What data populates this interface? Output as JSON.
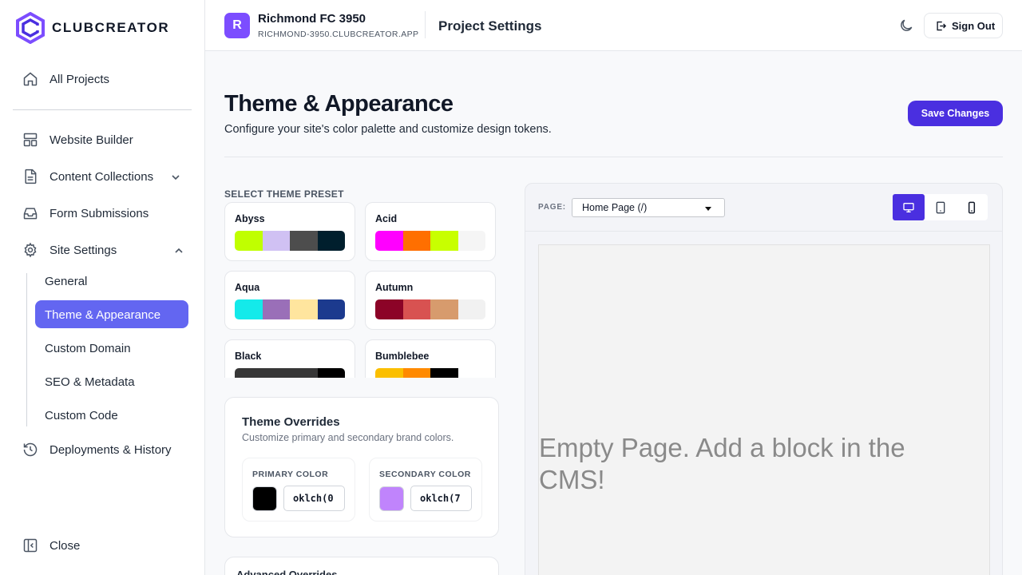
{
  "brand": {
    "name": "CLUBCREATOR"
  },
  "sidebar": {
    "all_projects": "All Projects",
    "items": [
      {
        "label": "Website Builder"
      },
      {
        "label": "Content Collections"
      },
      {
        "label": "Form Submissions"
      },
      {
        "label": "Site Settings"
      },
      {
        "label": "Deployments & History"
      }
    ],
    "sub_items": [
      "General",
      "Theme & Appearance",
      "Custom Domain",
      "SEO & Metadata",
      "Custom Code"
    ],
    "close_label": "Close"
  },
  "topbar": {
    "project_initial": "R",
    "project_name": "Richmond FC 3950",
    "project_url": "RICHMOND-3950.CLUBCREATOR.APP",
    "section_title": "Project Settings",
    "sign_out": "Sign Out"
  },
  "main": {
    "title": "Theme & Appearance",
    "subtitle": "Configure your site's color palette and customize design tokens.",
    "save_button": "Save Changes",
    "preset_label": "SELECT THEME PRESET",
    "presets": [
      {
        "name": "Abyss",
        "colors": [
          "#c0ff00",
          "#d0c1f3",
          "#4d4d4d",
          "#001f2d"
        ]
      },
      {
        "name": "Acid",
        "colors": [
          "#ff00ff",
          "#ff6f00",
          "#c8ff00",
          "#f5f5f5"
        ]
      },
      {
        "name": "Aqua",
        "colors": [
          "#14eaea",
          "#9a6fb8",
          "#ffe59e",
          "#1c3a8e"
        ]
      },
      {
        "name": "Autumn",
        "colors": [
          "#8c0327",
          "#d85251",
          "#d79b6d",
          "#f1f1f1"
        ]
      },
      {
        "name": "Black",
        "colors": [
          "#373737",
          "#373737",
          "#373737",
          "#000000"
        ]
      },
      {
        "name": "Bumblebee",
        "colors": [
          "#fbbf00",
          "#ff8a00",
          "#000000",
          "#ffffff"
        ]
      }
    ],
    "overrides": {
      "title": "Theme Overrides",
      "subtitle": "Customize primary and secondary brand colors.",
      "primary_label": "PRIMARY COLOR",
      "primary_value": "oklch(0",
      "primary_color": "#000000",
      "secondary_label": "SECONDARY COLOR",
      "secondary_value": "oklch(7",
      "secondary_color": "#c084fc"
    },
    "advanced_title": "Advanced Overrides"
  },
  "preview": {
    "page_label": "PAGE:",
    "page_selected": "Home Page (/)",
    "empty_message": "Empty Page. Add a block in the CMS!",
    "devices": [
      "desktop-icon",
      "tablet-icon",
      "mobile-icon"
    ]
  },
  "colors": {
    "accent": "#4a2fe0",
    "active_nav": "#6366f1"
  }
}
